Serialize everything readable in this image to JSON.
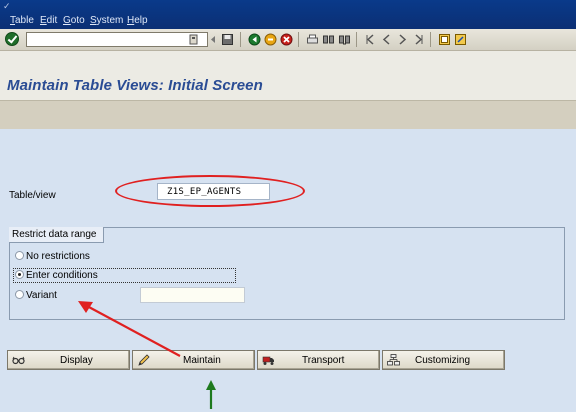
{
  "menubar": {
    "items": [
      "Table",
      "Edit",
      "Goto",
      "System",
      "Help"
    ]
  },
  "toolbar": {
    "command_field_value": "",
    "icons": [
      "enter-icon",
      "history-icon",
      "back-nav-icon",
      "save-icon",
      "back-icon",
      "exit-icon",
      "cancel-icon",
      "print-icon",
      "find-icon",
      "find-next-icon",
      "first-page-icon",
      "prev-page-icon",
      "next-page-icon",
      "last-page-icon",
      "new-session-icon",
      "shortcut-icon"
    ]
  },
  "title": "Maintain Table Views: Initial Screen",
  "form": {
    "table_view_label": "Table/view",
    "table_view_value": "Z1S_EP_AGENTS"
  },
  "restrict": {
    "group_title": "Restrict data range",
    "options": [
      "No restrictions",
      "Enter conditions",
      "Variant"
    ],
    "selected": "Enter conditions",
    "variant_value": ""
  },
  "buttons": {
    "display": "Display",
    "maintain": "Maintain",
    "transport": "Transport",
    "customizing": "Customizing"
  },
  "colors": {
    "menubar": "#0b3580",
    "title": "#2a4c94",
    "screen_bg": "#d6e2f1",
    "annotation_red": "#e02020",
    "annotation_green": "#1e7a1e"
  }
}
